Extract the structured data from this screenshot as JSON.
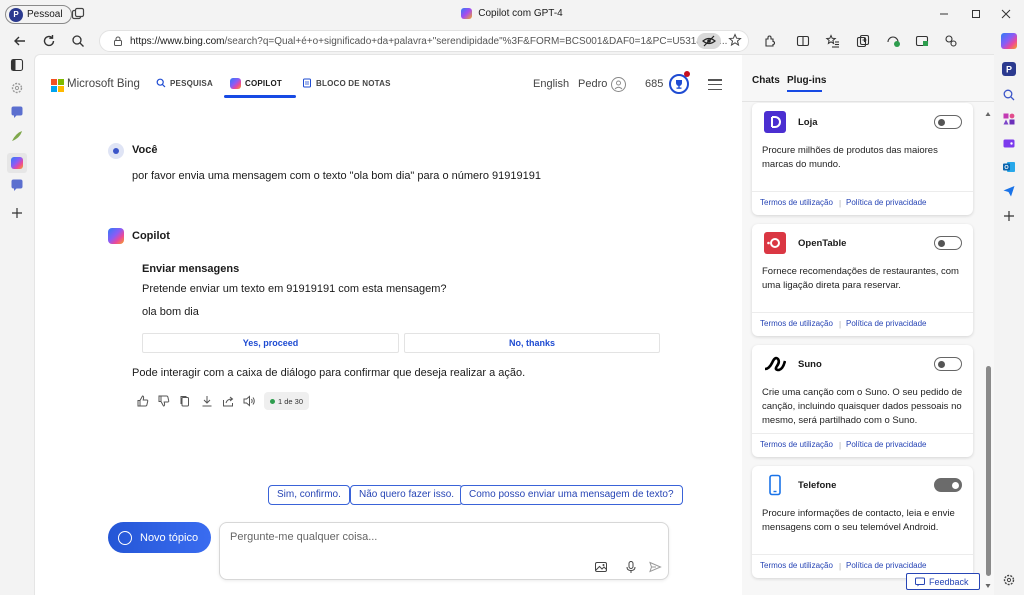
{
  "window": {
    "profile_label": "Pessoal",
    "title": "Copilot com GPT-4",
    "controls": [
      "minimize",
      "maximize",
      "close"
    ]
  },
  "address_bar": {
    "url_host": "https://www.bing.com",
    "url_rest": "/search?q=Qual+é+o+significado+da+palavra+\"serendipidade\"%3F&FORM=BCS001&DAF0=1&PC=U531&sho..."
  },
  "bing_header": {
    "brand": "Microsoft Bing",
    "nav": [
      {
        "label": "PESQUISA",
        "icon": "search-icon"
      },
      {
        "label": "COPILOT",
        "icon": "copilot-icon",
        "active": true
      },
      {
        "label": "BLOCO DE NOTAS",
        "icon": "notebook-icon"
      }
    ],
    "language": "English",
    "user_name": "Pedro",
    "reward_points": "685"
  },
  "conversation": {
    "user_speaker": "Você",
    "user_message": "por favor envia uma mensagem com o texto \"ola bom dia\" para o número 91919191",
    "assistant_speaker": "Copilot",
    "action_card": {
      "title": "Enviar mensagens",
      "prompt": "Pretende enviar um texto em 91919191 com esta mensagem?",
      "message": "ola bom dia",
      "confirm_label": "Yes, proceed",
      "decline_label": "No, thanks"
    },
    "assistant_followup": "Pode interagir com a caixa de diálogo para confirmar que deseja realizar a ação.",
    "response_counter": "1 de 30"
  },
  "suggestions": [
    "Sim, confirmo.",
    "Não quero fazer isso.",
    "Como posso enviar uma mensagem de texto?"
  ],
  "composer": {
    "new_topic_label": "Novo tópico",
    "placeholder": "Pergunte-me qualquer coisa..."
  },
  "plugin_panel": {
    "tabs": [
      {
        "label": "Chats",
        "active": false
      },
      {
        "label": "Plug-ins",
        "active": true
      }
    ],
    "plugins": [
      {
        "name": "Loja",
        "description": "Procure milhões de produtos das maiores marcas do mundo.",
        "enabled": false,
        "terms": "Termos de utilização",
        "privacy": "Política de privacidade",
        "logo_color": "#4b2fd1"
      },
      {
        "name": "OpenTable",
        "description": "Fornece recomendações de restaurantes, com uma ligação direta para reservar.",
        "enabled": false,
        "terms": "Termos de utilização",
        "privacy": "Política de privacidade",
        "logo_color": "#da3743"
      },
      {
        "name": "Suno",
        "description": "Crie uma canção com o Suno. O seu pedido de canção, incluindo quaisquer dados pessoais no mesmo, será partilhado com o Suno.",
        "enabled": false,
        "terms": "Termos de utilização",
        "privacy": "Política de privacidade",
        "logo_color": "#000000"
      },
      {
        "name": "Telefone",
        "description": "Procure informações de contacto, leia e envie mensagens com o seu telemóvel Android.",
        "enabled": true,
        "terms": "Termos de utilização",
        "privacy": "Política de privacidade",
        "logo_color": "#1a73e8"
      }
    ],
    "feedback_label": "Feedback"
  },
  "colors": {
    "accent_blue": "#174ae4",
    "link_blue": "#2745b5"
  }
}
